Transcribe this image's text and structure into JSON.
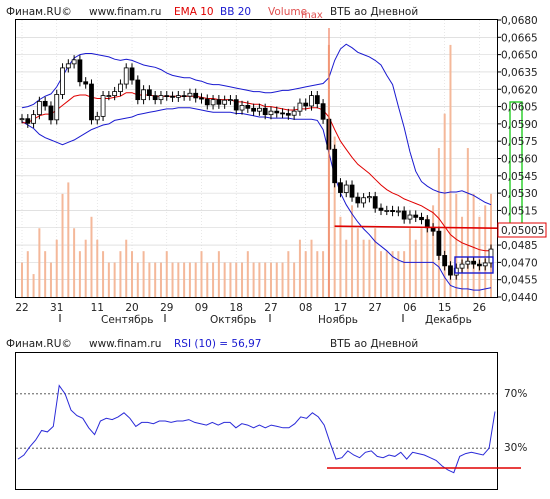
{
  "price_chart": {
    "source_label": "Финам.RU©",
    "site_label": "www.finam.ru",
    "ema_label": "EMA 10",
    "bb_label": "BB 20",
    "volume_label": "Volume",
    "max_label": "max",
    "title": "ВТБ ао Дневной",
    "price_tag": "0,05005",
    "y_ticks": [
      "0,0680",
      "0,0665",
      "0,0650",
      "0,0635",
      "0,0620",
      "0,0605",
      "0,0590",
      "0,0575",
      "0,0560",
      "0,0545",
      "0,0530",
      "0,0515",
      "0,0500",
      "0,0485",
      "0,0470",
      "0,0455",
      "0,0440"
    ],
    "day_ticks": [
      "22",
      "31",
      "11",
      "20",
      "29",
      "09",
      "18",
      "27",
      "08",
      "17",
      "27",
      "06",
      "15",
      "26"
    ],
    "months": [
      "Сентябрь",
      "Октябрь",
      "Ноябрь",
      "Декабрь"
    ]
  },
  "rsi_chart": {
    "source_label": "Финам.RU©",
    "site_label": "www.finam.ru",
    "rsi_label": "RSI (10) = 56,97",
    "title": "ВТБ ао Дневной",
    "levels": [
      "70%",
      "30%"
    ]
  },
  "colors": {
    "ema": "#e00000",
    "bollinger": "#1a1ad0",
    "volume": "#f4b89a",
    "rsi": "#2a2ad8",
    "support": "#e00000",
    "highlight_box": "#1a1ad0",
    "green_box": "#22cc22"
  },
  "chart_data": {
    "type": "candlestick",
    "ylim": [
      0.044,
      0.068
    ],
    "close": [
      0.05945,
      0.05905,
      0.0598,
      0.06095,
      0.06055,
      0.05935,
      0.06155,
      0.06385,
      0.0642,
      0.06455,
      0.06265,
      0.06245,
      0.05935,
      0.05965,
      0.06145,
      0.06145,
      0.0618,
      0.06245,
      0.06385,
      0.0628,
      0.0611,
      0.06195,
      0.06145,
      0.0611,
      0.06145,
      0.0614,
      0.0613,
      0.06145,
      0.0614,
      0.06165,
      0.06125,
      0.06115,
      0.06065,
      0.0611,
      0.0607,
      0.06105,
      0.0611,
      0.0602,
      0.0606,
      0.06035,
      0.0601,
      0.06035,
      0.0598,
      0.0601,
      0.05995,
      0.0599,
      0.05975,
      0.0601,
      0.0608,
      0.06055,
      0.06145,
      0.06075,
      0.0594,
      0.0568,
      0.0539,
      0.05305,
      0.0537,
      0.05265,
      0.05215,
      0.0526,
      0.0527,
      0.0517,
      0.0515,
      0.0515,
      0.0514,
      0.05145,
      0.05075,
      0.0511,
      0.0509,
      0.0507,
      0.05,
      0.0497,
      0.0476,
      0.0467,
      0.0459,
      0.0465,
      0.04685,
      0.0471,
      0.04685,
      0.0467,
      0.04695,
      0.04815
    ],
    "ema10": [
      0.0591,
      0.0591,
      0.0594,
      0.0597,
      0.05985,
      0.05985,
      0.0602,
      0.0606,
      0.061,
      0.0614,
      0.0615,
      0.0615,
      0.0613,
      0.0612,
      0.0612,
      0.0612,
      0.0613,
      0.0614,
      0.0617,
      0.0617,
      0.0615,
      0.0615,
      0.0615,
      0.0614,
      0.0614,
      0.0614,
      0.0614,
      0.0614,
      0.0614,
      0.0614,
      0.0614,
      0.0613,
      0.0612,
      0.0612,
      0.0611,
      0.0611,
      0.0611,
      0.0609,
      0.0609,
      0.0608,
      0.0607,
      0.0607,
      0.0605,
      0.0605,
      0.0604,
      0.0603,
      0.0602,
      0.0602,
      0.0603,
      0.0603,
      0.0604,
      0.0604,
      0.0602,
      0.0596,
      0.0585,
      0.0575,
      0.0568,
      0.0561,
      0.0555,
      0.0551,
      0.0547,
      0.0542,
      0.0537,
      0.0533,
      0.053,
      0.0528,
      0.0525,
      0.0523,
      0.0521,
      0.0519,
      0.0516,
      0.0513,
      0.0508,
      0.0501,
      0.0494,
      0.049,
      0.0487,
      0.0485,
      0.0483,
      0.0481,
      0.048,
      0.048
    ],
    "bb_upper": [
      0.0604,
      0.0605,
      0.0607,
      0.0611,
      0.0614,
      0.0616,
      0.0622,
      0.0631,
      0.064,
      0.0647,
      0.065,
      0.0651,
      0.0651,
      0.065,
      0.0649,
      0.0648,
      0.0646,
      0.0645,
      0.0646,
      0.0645,
      0.0643,
      0.0641,
      0.064,
      0.0639,
      0.0637,
      0.0634,
      0.0632,
      0.0631,
      0.063,
      0.063,
      0.0628,
      0.0627,
      0.0625,
      0.0624,
      0.0624,
      0.0623,
      0.0622,
      0.0621,
      0.062,
      0.0619,
      0.0618,
      0.0618,
      0.0617,
      0.0617,
      0.0618,
      0.0619,
      0.0619,
      0.062,
      0.0621,
      0.0622,
      0.0623,
      0.0624,
      0.0625,
      0.063,
      0.0645,
      0.0655,
      0.0659,
      0.0656,
      0.0652,
      0.065,
      0.0648,
      0.0645,
      0.0641,
      0.0632,
      0.0624,
      0.0605,
      0.0587,
      0.0566,
      0.0549,
      0.054,
      0.0536,
      0.0533,
      0.0531,
      0.053,
      0.0531,
      0.0531,
      0.0532,
      0.053,
      0.0528,
      0.0525,
      0.0522,
      0.052
    ],
    "bb_lower": [
      0.0592,
      0.0589,
      0.0586,
      0.0581,
      0.0578,
      0.0576,
      0.0574,
      0.0572,
      0.0574,
      0.0576,
      0.0579,
      0.0582,
      0.0585,
      0.0587,
      0.0589,
      0.059,
      0.0593,
      0.0594,
      0.0595,
      0.0596,
      0.0598,
      0.0599,
      0.06,
      0.0601,
      0.0602,
      0.0603,
      0.0603,
      0.0604,
      0.0604,
      0.0604,
      0.0603,
      0.0602,
      0.0601,
      0.06,
      0.06,
      0.06,
      0.06,
      0.0599,
      0.0599,
      0.0598,
      0.0597,
      0.0596,
      0.0596,
      0.0595,
      0.0595,
      0.0595,
      0.0595,
      0.0594,
      0.0594,
      0.0594,
      0.0594,
      0.0593,
      0.0585,
      0.0565,
      0.0545,
      0.053,
      0.052,
      0.0512,
      0.0505,
      0.0499,
      0.0494,
      0.0488,
      0.0484,
      0.048,
      0.0475,
      0.0472,
      0.047,
      0.047,
      0.047,
      0.047,
      0.047,
      0.047,
      0.0466,
      0.0457,
      0.045,
      0.0448,
      0.0447,
      0.0447,
      0.0446,
      0.0446,
      0.0447,
      0.0448
    ],
    "volume": [
      3,
      4,
      2,
      6,
      4,
      3,
      5,
      9,
      10,
      6,
      4,
      5,
      7,
      5,
      4,
      3,
      3,
      4,
      5,
      4,
      3,
      4,
      3,
      3,
      3,
      4,
      3,
      3,
      3,
      3,
      3,
      4,
      3,
      3,
      4,
      3,
      3,
      3,
      3,
      4,
      3,
      3,
      3,
      3,
      3,
      3,
      4,
      3,
      5,
      4,
      5,
      4,
      4,
      22,
      14,
      7,
      5,
      8,
      6,
      5,
      5,
      6,
      4,
      4,
      4,
      4,
      4,
      6,
      5,
      6,
      7,
      8,
      13,
      16,
      22,
      9,
      7,
      13,
      9,
      7,
      8,
      9
    ],
    "rsi": [
      22,
      25,
      31,
      36,
      43,
      42,
      46,
      76,
      70,
      58,
      54,
      52,
      45,
      40,
      50,
      52,
      51,
      53,
      56,
      52,
      46,
      49,
      49,
      48,
      50,
      50,
      49,
      50,
      50,
      51,
      49,
      48,
      47,
      49,
      47,
      49,
      49,
      45,
      48,
      47,
      45,
      47,
      45,
      47,
      46,
      45,
      45,
      48,
      53,
      52,
      56,
      53,
      47,
      34,
      22,
      23,
      28,
      25,
      23,
      27,
      28,
      24,
      23,
      25,
      24,
      27,
      22,
      27,
      26,
      25,
      23,
      21,
      17,
      14,
      12,
      24,
      26,
      27,
      26,
      25,
      30,
      57
    ],
    "support_level": 0.05005,
    "last_price": 0.05005,
    "rsi_levels": [
      70,
      30
    ],
    "x_tick_labels": [
      "22",
      "31",
      "11",
      "20",
      "29",
      "09",
      "18",
      "27",
      "08",
      "17",
      "27",
      "06",
      "15",
      "26"
    ],
    "month_labels": [
      "Сентябрь",
      "Октябрь",
      "Ноябрь",
      "Декабрь"
    ]
  }
}
